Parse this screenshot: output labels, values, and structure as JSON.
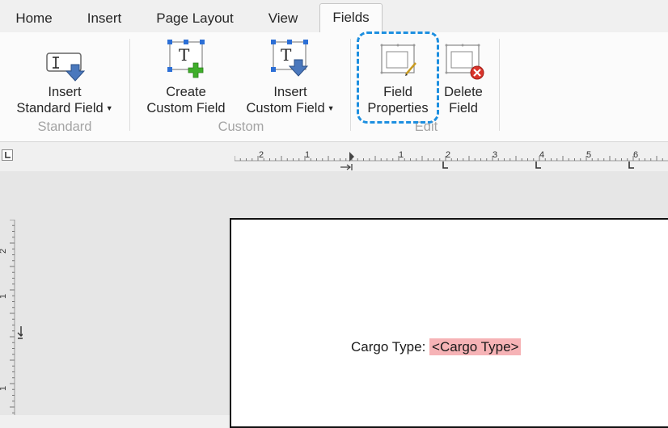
{
  "tabs": [
    {
      "label": "Home"
    },
    {
      "label": "Insert"
    },
    {
      "label": "Page Layout"
    },
    {
      "label": "View"
    },
    {
      "label": "Fields"
    }
  ],
  "ribbon": {
    "insert_standard_field": {
      "line1": "Insert",
      "line2": "Standard Field",
      "icon": "text-cursor-field-icon"
    },
    "create_custom_field": {
      "line1": "Create",
      "line2": "Custom Field",
      "icon": "text-field-add-icon"
    },
    "insert_custom_field": {
      "line1": "Insert",
      "line2": "Custom Field",
      "icon": "text-field-insert-icon"
    },
    "field_properties": {
      "line1": "Field",
      "line2": "Properties",
      "icon": "field-properties-icon"
    },
    "delete_field": {
      "line1": "Delete",
      "line2": "Field",
      "icon": "field-delete-icon"
    },
    "groups": {
      "standard": "Standard",
      "custom": "Custom",
      "edit": "Edit"
    },
    "highlight_color": "#1d8fe0"
  },
  "hruler": {
    "numbers": [
      "2",
      "1",
      "1",
      "2",
      "3",
      "4",
      "5",
      "6"
    ]
  },
  "vruler": {
    "numbers": [
      "2",
      "1",
      "1"
    ]
  },
  "document": {
    "label": "Cargo Type:",
    "field_token": "<Cargo Type>",
    "field_token_color": "#f6b3b6"
  }
}
